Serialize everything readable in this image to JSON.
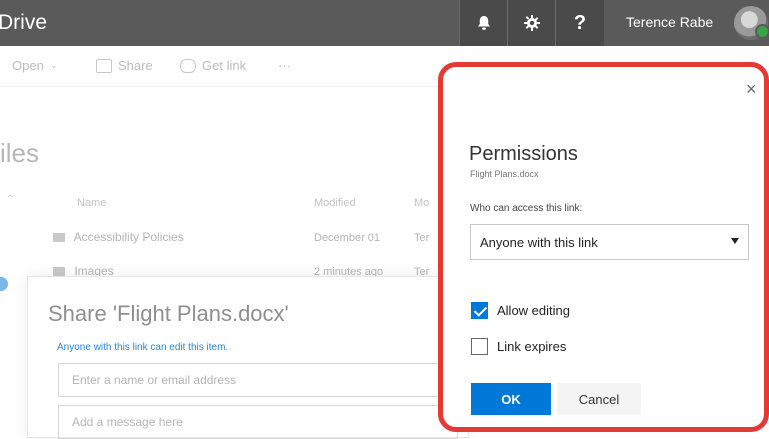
{
  "header": {
    "app_title": "Drive",
    "app_title_visible": "Drive",
    "user_name": "Terence Rabe",
    "help_label": "?"
  },
  "command_bar": {
    "open_label": "Open",
    "share_label": "Share",
    "getlink_label": "Get link",
    "more_label": "···"
  },
  "files": {
    "title": "Files",
    "title_visible": "iles",
    "columns": [
      "Name",
      "Modified",
      "Mo"
    ],
    "rows": [
      {
        "name": "Accessibility Policies",
        "modified": "December 01",
        "by": "Ter"
      },
      {
        "name": "Images",
        "modified": "2 minutes ago",
        "by": "Ter"
      }
    ]
  },
  "share_panel": {
    "title": "Share 'Flight Plans.docx'",
    "subtitle": "Anyone with this link can edit this item.",
    "name_placeholder": "Enter a name or email address",
    "message_placeholder": "Add a message here"
  },
  "permissions": {
    "title": "Permissions",
    "file_name": "Flight Plans.docx",
    "question": "Who can access this link:",
    "selected_option": "Anyone with this link",
    "allow_editing_label": "Allow editing",
    "allow_editing_checked": true,
    "link_expires_label": "Link expires",
    "link_expires_checked": false,
    "ok_label": "OK",
    "cancel_label": "Cancel",
    "close_glyph": "×"
  },
  "colors": {
    "topbar": "#5a5a5a",
    "accent": "#0078d7",
    "highlight_border": "#e53935"
  }
}
